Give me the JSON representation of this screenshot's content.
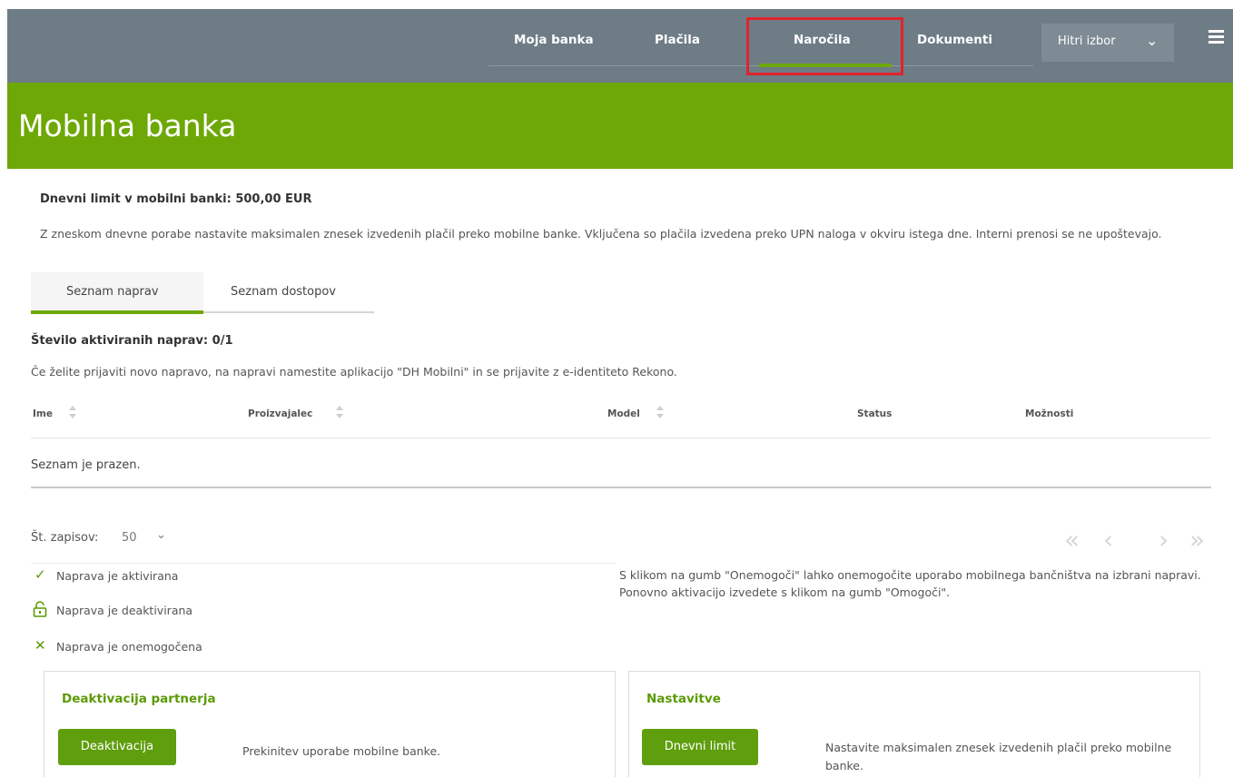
{
  "nav": {
    "items": [
      "Moja banka",
      "Plačila",
      "Naročila",
      "Dokumenti"
    ],
    "active": "Naročila",
    "quick_select": "Hitri izbor"
  },
  "colors": {
    "brand_green": "#6ea807",
    "nav_gray": "#6e7c86",
    "highlight_red": "#e0242c"
  },
  "banner": {
    "title": "Mobilna banka"
  },
  "limit": {
    "title": "Dnevni limit v mobilni banki: 500,00 EUR",
    "description": "Z zneskom dnevne porabe nastavite maksimalen znesek izvedenih plačil preko mobilne banke. Vključena so plačila izvedena preko UPN naloga v okviru istega dne. Interni prenosi se ne upoštevajo."
  },
  "tabs": [
    "Seznam naprav",
    "Seznam dostopov"
  ],
  "devices": {
    "count_label": "Število aktiviranih naprav: 0/1",
    "hint": "Če želite prijaviti novo napravo, na napravi namestite aplikacijo \"DH Mobilni\" in se prijavite z e-identiteto Rekono.",
    "columns": [
      "Ime",
      "Proizvajalec",
      "Model",
      "Status",
      "Možnosti"
    ],
    "empty_text": "Seznam je prazen."
  },
  "pagination": {
    "records_label": "Št. zapisov:",
    "records_value": "50"
  },
  "legend": [
    {
      "icon": "check-icon",
      "text": "Naprava je aktivirana",
      "color": "#5b9a06"
    },
    {
      "icon": "unlock-icon",
      "text": "Naprava je deaktivirana",
      "color": "#5b9a06"
    },
    {
      "icon": "cross-icon",
      "text": "Naprava je onemogočena",
      "color": "#5b9a06"
    }
  ],
  "info_text": "S klikom na gumb \"Onemogoči\" lahko onemogočite uporabo mobilnega bančništva na izbrani napravi. Ponovno aktivacijo izvedete s klikom na gumb \"Omogoči\".",
  "cards": {
    "deactivation": {
      "title": "Deaktivacija partnerja",
      "button": "Deaktivacija",
      "text": "Prekinitev uporabe mobilne banke."
    },
    "settings": {
      "title": "Nastavitve",
      "button": "Dnevni limit",
      "text": "Nastavite maksimalen znesek izvedenih plačil preko mobilne banke."
    }
  }
}
